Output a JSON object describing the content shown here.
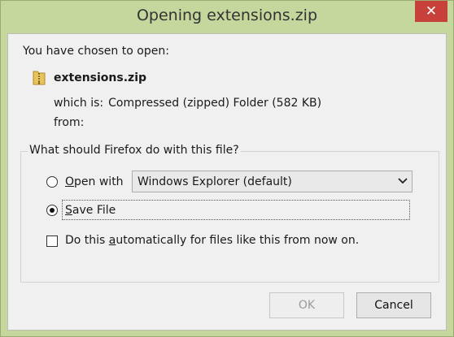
{
  "window": {
    "title": "Opening extensions.zip",
    "close_glyph": "✕"
  },
  "intro_text": "You have chosen to open:",
  "file": {
    "icon": "folder-zip-icon",
    "name": "extensions.zip",
    "which_is_label": "which is:",
    "type_text": "Compressed (zipped) Folder (582 KB)",
    "from_label": "from:"
  },
  "action_group": {
    "legend": "What should Firefox do with this file?",
    "open_with": {
      "label_mnemonic": "O",
      "label_rest": "pen with",
      "checked": false,
      "application": "Windows Explorer (default)"
    },
    "save_file": {
      "label_mnemonic": "S",
      "label_rest": "ave File",
      "checked": true
    },
    "auto_checkbox": {
      "label_pre": "Do this ",
      "label_mnemonic": "a",
      "label_post": "utomatically for files like this from now on.",
      "checked": false
    }
  },
  "buttons": {
    "ok": "OK",
    "cancel": "Cancel"
  },
  "colors": {
    "title_bar": "#c5d79c",
    "close_button": "#c7413a",
    "client_bg": "#f0f0f0"
  }
}
